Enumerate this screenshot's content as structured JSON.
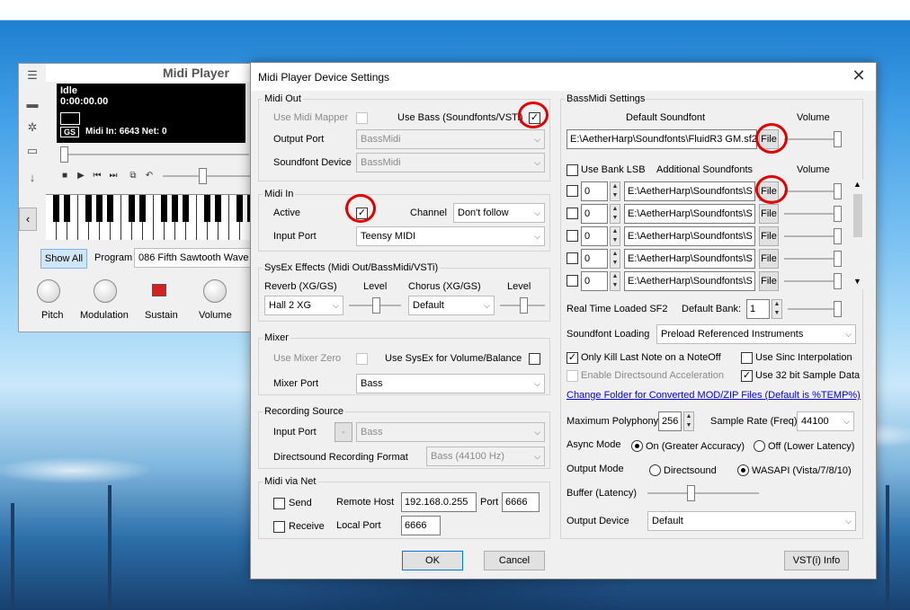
{
  "midi_player": {
    "title": "Midi Player",
    "display_status": "Idle",
    "display_time": "0:00:00.00",
    "display_mode": "GS",
    "display_counts": "Midi In: 6643  Net: 0",
    "show_all_label": "Show All",
    "program_label": "Program",
    "program_value": "086 Fifth Sawtooth Wave",
    "knob_labels": [
      "Pitch",
      "Modulation",
      "Sustain",
      "Volume"
    ]
  },
  "dialog": {
    "title": "Midi Player Device Settings",
    "close_glyph": "✕",
    "midi_out": {
      "group_label": "Midi Out",
      "use_midi_mapper_label": "Use Midi Mapper",
      "use_bass_label": "Use Bass (Soundfonts/VSTi)",
      "output_port_label": "Output Port",
      "output_port_value": "BassMidi",
      "soundfont_device_label": "Soundfont Device",
      "soundfont_device_value": "BassMidi"
    },
    "midi_in": {
      "group_label": "Midi In",
      "active_label": "Active",
      "channel_label": "Channel",
      "channel_value": "Don't follow",
      "input_port_label": "Input Port",
      "input_port_value": "Teensy MIDI"
    },
    "sysex": {
      "group_label": "SysEx Effects (Midi Out/BassMidi/VSTi)",
      "reverb_label": "Reverb (XG/GS)",
      "reverb_level_label": "Level",
      "reverb_value": "Hall 2 XG",
      "chorus_label": "Chorus (XG/GS)",
      "chorus_level_label": "Level",
      "chorus_value": "Default"
    },
    "mixer": {
      "group_label": "Mixer",
      "use_mixer_zero_label": "Use Mixer Zero",
      "use_sysex_label": "Use SysEx for Volume/Balance",
      "mixer_port_label": "Mixer Port",
      "mixer_port_value": "Bass"
    },
    "recording": {
      "group_label": "Recording Source",
      "input_port_label": "Input Port",
      "input_port_btn": "-",
      "input_port_value": "Bass",
      "ds_format_label": "Directsound Recording Format",
      "ds_format_value": "Bass (44100 Hz)"
    },
    "midi_net": {
      "group_label": "Midi via Net",
      "send_label": "Send",
      "remote_host_label": "Remote Host",
      "remote_host_value": "192.168.0.255",
      "port_label": "Port",
      "port_value": "6666",
      "receive_label": "Receive",
      "local_port_label": "Local Port",
      "local_port_value": "6666"
    },
    "bassmidi": {
      "group_label": "BassMidi Settings",
      "default_soundfont_label": "Default Soundfont",
      "volume_label": "Volume",
      "default_soundfont_path": "E:\\AetherHarp\\Soundfonts\\FluidR3 GM.sf2",
      "file_label": "File",
      "use_bank_lsb_label": "Use Bank LSB",
      "additional_soundfonts_label": "Additional Soundfonts",
      "additional_volume_label": "Volume",
      "soundfont_rows": [
        {
          "bank": "0",
          "path": "E:\\AetherHarp\\Soundfonts\\S"
        },
        {
          "bank": "0",
          "path": "E:\\AetherHarp\\Soundfonts\\S"
        },
        {
          "bank": "0",
          "path": "E:\\AetherHarp\\Soundfonts\\S"
        },
        {
          "bank": "0",
          "path": "E:\\AetherHarp\\Soundfonts\\S"
        },
        {
          "bank": "0",
          "path": "E:\\AetherHarp\\Soundfonts\\S"
        }
      ],
      "realtime_label": "Real Time Loaded SF2",
      "default_bank_label": "Default Bank:",
      "default_bank_value": "1",
      "loading_label": "Soundfont Loading",
      "loading_value": "Preload Referenced Instruments",
      "only_kill_label": "Only Kill Last Note on a NoteOff",
      "sinc_label": "Use Sinc Interpolation",
      "ds_accel_label": "Enable Directsound Acceleration",
      "use32_label": "Use 32 bit Sample Data",
      "change_folder_link": "Change Folder for Converted MOD/ZIP Files (Default is %TEMP%)",
      "max_poly_label": "Maximum Polyphony",
      "max_poly_value": "256",
      "sample_rate_label": "Sample Rate (Freq)",
      "sample_rate_value": "44100",
      "async_label": "Async Mode",
      "async_on_label": "On (Greater Accuracy)",
      "async_off_label": "Off (Lower Latency)",
      "output_mode_label": "Output Mode",
      "ds_label": "Directsound",
      "wasapi_label": "WASAPI (Vista/7/8/10)",
      "buffer_label": "Buffer (Latency)",
      "output_device_label": "Output Device",
      "output_device_value": "Default"
    },
    "ok_label": "OK",
    "cancel_label": "Cancel",
    "vst_info_label": "VST(i) Info",
    "check_glyph": "✓",
    "dropdown_glyph": "⌵",
    "highlight_color": "#e00000"
  }
}
